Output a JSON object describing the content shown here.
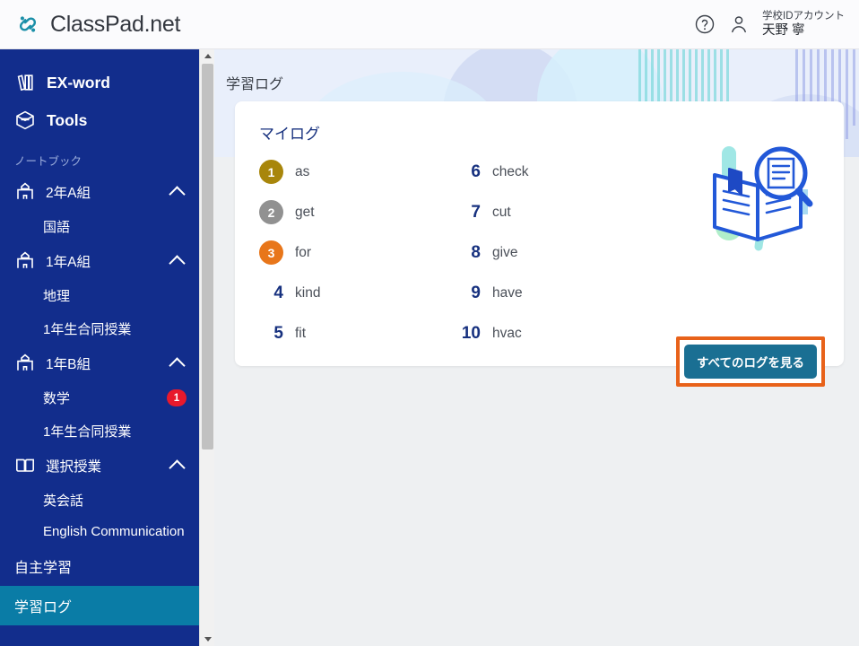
{
  "header": {
    "brand_name": "ClassPad.net",
    "brand_logo_icon": "link-loop-icon",
    "help_icon": "help-circle-icon",
    "person_icon": "person-icon",
    "account_type": "学校IDアカウント",
    "account_name": "天野 寧"
  },
  "sidebar": {
    "main_items": [
      {
        "label": "EX-word",
        "icon": "dictionary-books-icon"
      },
      {
        "label": "Tools",
        "icon": "cube-box-icon"
      }
    ],
    "section_label": "ノートブック",
    "groups": [
      {
        "label": "2年A組",
        "icon": "school-building-icon",
        "expanded_icon": "chevron-up-icon",
        "children": [
          {
            "label": "国語",
            "badge": ""
          }
        ]
      },
      {
        "label": "1年A組",
        "icon": "school-building-icon",
        "expanded_icon": "chevron-up-icon",
        "children": [
          {
            "label": "地理",
            "badge": ""
          },
          {
            "label": "1年生合同授業",
            "badge": ""
          }
        ]
      },
      {
        "label": "1年B組",
        "icon": "school-building-icon",
        "expanded_icon": "chevron-up-icon",
        "children": [
          {
            "label": "数学",
            "badge": "1"
          },
          {
            "label": "1年生合同授業",
            "badge": ""
          }
        ]
      },
      {
        "label": "選択授業",
        "icon": "open-book-icon",
        "expanded_icon": "chevron-up-icon",
        "children": [
          {
            "label": "英会話",
            "badge": ""
          },
          {
            "label": "English Communication",
            "badge": ""
          }
        ]
      }
    ],
    "plain_items": [
      {
        "label": "自主学習",
        "active": false
      },
      {
        "label": "学習ログ",
        "active": true
      }
    ],
    "scrollbar": {
      "up_icon": "scroll-up-arrow-icon",
      "down_icon": "scroll-down-arrow-icon"
    }
  },
  "main": {
    "page_title": "学習ログ",
    "card": {
      "title": "マイログ",
      "illustration_icon": "book-magnifier-illustration",
      "log_items": [
        {
          "rank": "1",
          "word": "as",
          "badge_color": "#a8860b"
        },
        {
          "rank": "2",
          "word": "get",
          "badge_color": "#919191"
        },
        {
          "rank": "3",
          "word": "for",
          "badge_color": "#e8761a"
        },
        {
          "rank": "4",
          "word": "kind",
          "badge_color": ""
        },
        {
          "rank": "5",
          "word": "fit",
          "badge_color": ""
        },
        {
          "rank": "6",
          "word": "check",
          "badge_color": ""
        },
        {
          "rank": "7",
          "word": "cut",
          "badge_color": ""
        },
        {
          "rank": "8",
          "word": "give",
          "badge_color": ""
        },
        {
          "rank": "9",
          "word": "have",
          "badge_color": ""
        },
        {
          "rank": "10",
          "word": "hvac",
          "badge_color": ""
        }
      ],
      "all_logs_button": "すべてのログを見る"
    }
  },
  "colors": {
    "sidebar_navy": "#122d8c",
    "active_teal": "#0a7ca6",
    "button_teal": "#1a6f93",
    "highlight_orange": "#e8621a",
    "badge_red": "#e8192c",
    "title_navy": "#17317f"
  }
}
